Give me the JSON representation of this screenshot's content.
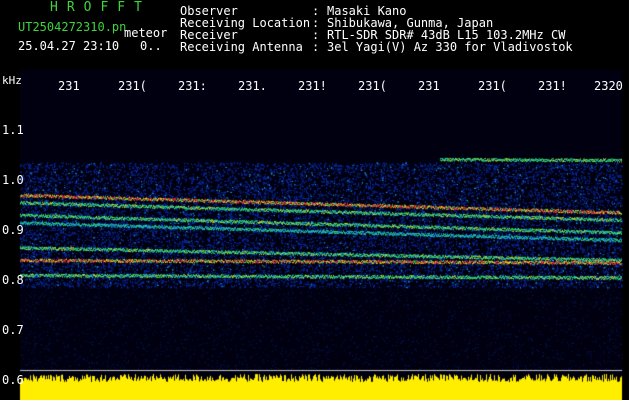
{
  "header": {
    "brand": "HROFFT",
    "filename": "UT2504272310.pn",
    "meteor_label": "meteor",
    "date_time": "25.04.27 23:10",
    "dot_value": "0..",
    "fields": [
      {
        "label": "Observer",
        "value": "Masaki Kano"
      },
      {
        "label": "Receiving Location",
        "value": "Shibukawa, Gunma, Japan"
      },
      {
        "label": "Receiver",
        "value": "RTL-SDR SDR# 43dB L15 103.2MHz CW"
      },
      {
        "label": "Receiving Antenna",
        "value": "3el Yagi(V) Az 330 for Vladivostok"
      }
    ]
  },
  "chart_data": {
    "type": "heatmap",
    "ylabel": "kHz",
    "ylim": [
      0.6,
      1.1
    ],
    "yticks": [
      "1.1",
      "1.0",
      "0.9",
      "0.8",
      "0.7",
      "0.6"
    ],
    "xticks": [
      "231",
      "231(",
      "231:",
      "231.",
      "231!",
      "231(",
      "231",
      "231(",
      "231!",
      "2320"
    ],
    "signals": [
      {
        "freq_start": 0.97,
        "freq_end": 0.935,
        "strength": "strong"
      },
      {
        "freq_start": 0.955,
        "freq_end": 0.92,
        "strength": "medium"
      },
      {
        "freq_start": 0.93,
        "freq_end": 0.895,
        "strength": "medium"
      },
      {
        "freq_start": 0.915,
        "freq_end": 0.88,
        "strength": "weak"
      },
      {
        "freq_start": 0.865,
        "freq_end": 0.84,
        "strength": "medium"
      },
      {
        "freq_start": 0.84,
        "freq_end": 0.835,
        "strength": "strong"
      },
      {
        "freq_start": 0.81,
        "freq_end": 0.805,
        "strength": "medium"
      },
      {
        "freq_start": 1.045,
        "freq_end": 1.04,
        "strength": "medium"
      }
    ],
    "colors": {
      "background": "#000010",
      "noise": "#1030c0",
      "weak": "#18b0e0",
      "medium": "#30e070",
      "strong": "#ff3030",
      "bottom_bar": "#ffee00"
    }
  }
}
